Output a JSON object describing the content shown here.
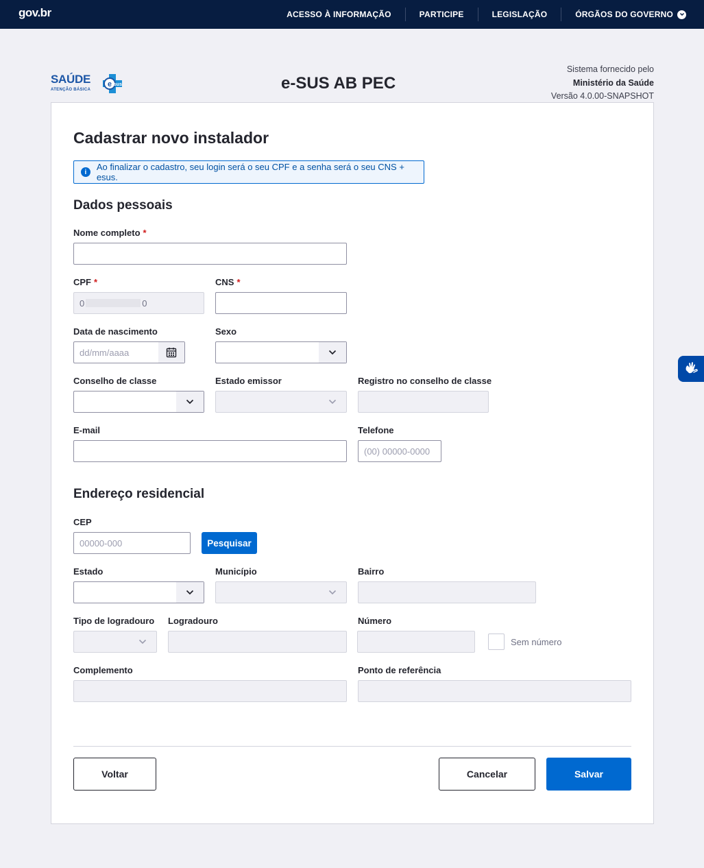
{
  "topbar": {
    "logo": "gov.br",
    "nav": [
      "ACESSO À INFORMAÇÃO",
      "PARTICIPE",
      "LEGISLAÇÃO",
      "ÓRGÃOS DO GOVERNO"
    ]
  },
  "header": {
    "brand_title": "SAÚDE",
    "brand_sub": "ATENÇÃO BÁSICA",
    "brand_badge": "esus",
    "app_title": "e-SUS AB PEC",
    "provider_line1": "Sistema fornecido pelo",
    "provider_line2": "Ministério da Saúde",
    "provider_line3": "Versão 4.0.00-SNAPSHOT"
  },
  "form": {
    "title": "Cadastrar novo instalador",
    "alert": "Ao finalizar o cadastro, seu login será o seu CPF e a senha será o seu CNS + esus.",
    "section_personal": "Dados pessoais",
    "section_address": "Endereço residencial",
    "labels": {
      "nome": "Nome completo",
      "cpf": "CPF",
      "cns": "CNS",
      "nascimento": "Data de nascimento",
      "sexo": "Sexo",
      "conselho": "Conselho de classe",
      "estado_emissor": "Estado emissor",
      "registro": "Registro no conselho de classe",
      "email": "E-mail",
      "telefone": "Telefone",
      "cep": "CEP",
      "estado": "Estado",
      "municipio": "Município",
      "bairro": "Bairro",
      "tipo_logradouro": "Tipo de logradouro",
      "logradouro": "Logradouro",
      "numero": "Número",
      "sem_numero": "Sem número",
      "complemento": "Complemento",
      "referencia": "Ponto de referência"
    },
    "required_mark": "*",
    "values": {
      "cpf_start": "0",
      "cpf_end": "0"
    },
    "placeholders": {
      "nascimento": "dd/mm/aaaa",
      "telefone": "(00) 00000-0000",
      "cep": "00000-000"
    },
    "buttons": {
      "pesquisar": "Pesquisar",
      "voltar": "Voltar",
      "cancelar": "Cancelar",
      "salvar": "Salvar"
    }
  },
  "colors": {
    "topbar": "#071d41",
    "primary": "#0069d0",
    "brand": "#1c56a6",
    "background": "#f0f0f5"
  }
}
